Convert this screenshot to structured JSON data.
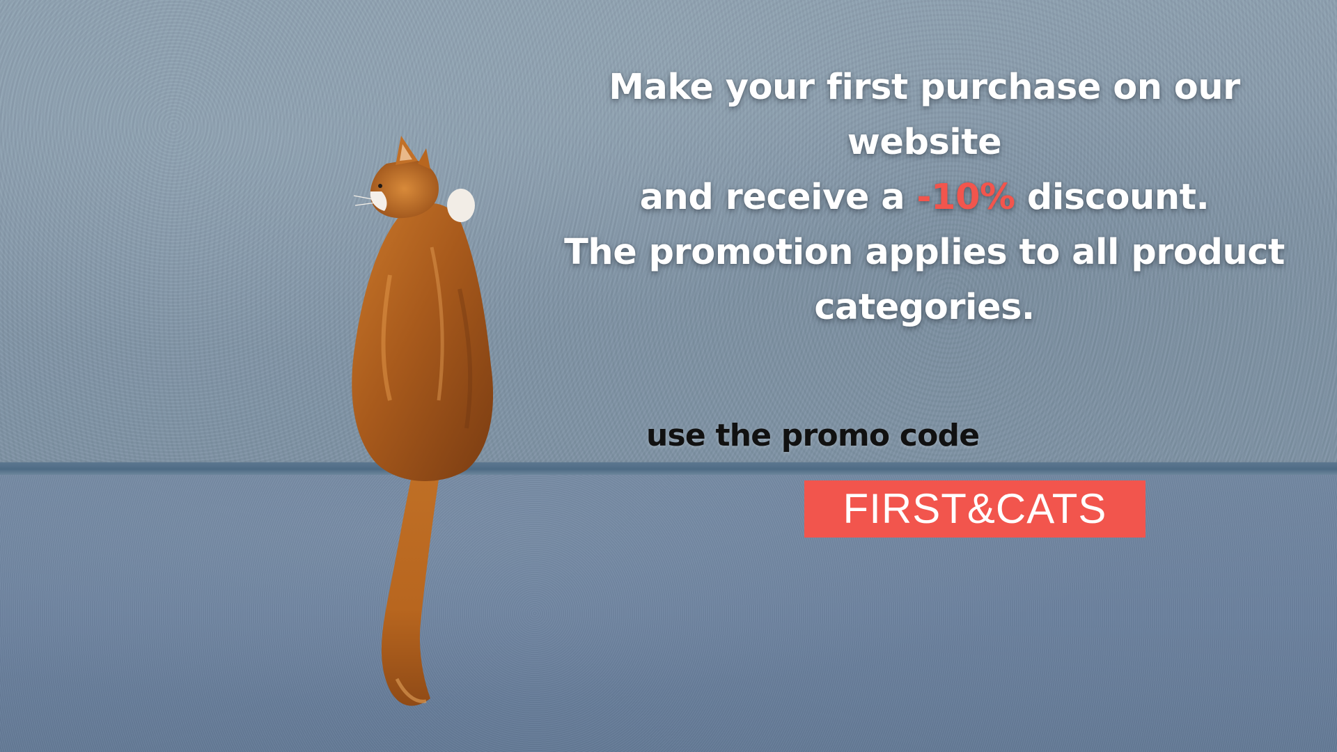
{
  "headline": {
    "line1": "Make your first purchase on our website",
    "line2_before": "and receive a ",
    "line2_discount": "-10%",
    "line2_after": " discount.",
    "line3": "The promotion applies to all product",
    "line4": "categories."
  },
  "promo": {
    "label": "use the promo code",
    "code": "FIRST&CATS"
  },
  "colors": {
    "accent": "#f2554d",
    "headline_text": "#ffffff",
    "label_text": "#111111",
    "wall": "#8699aa"
  }
}
